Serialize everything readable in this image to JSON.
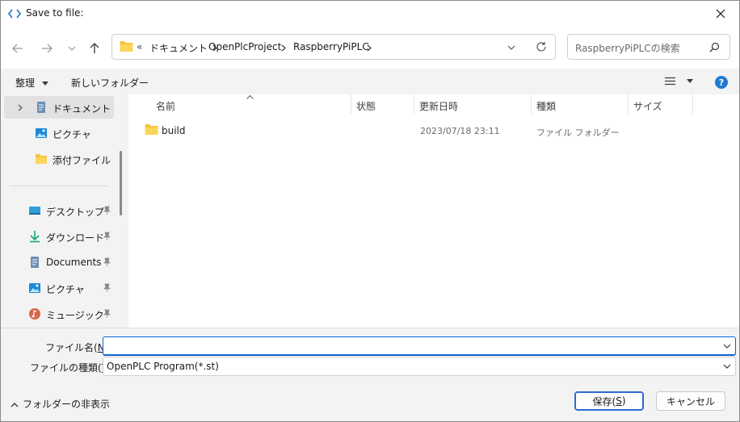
{
  "window": {
    "title": "Save to file:",
    "close_icon": "close-icon"
  },
  "nav": {
    "back_icon": "arrow-left-icon",
    "forward_icon": "arrow-right-icon",
    "recent_icon": "chevron-down-icon",
    "up_icon": "arrow-up-icon",
    "address": {
      "overflow": "«",
      "segments": [
        "ドキュメント",
        "OpenPlcProject",
        "RaspberryPiPLC"
      ]
    },
    "search_placeholder": "RaspberryPiPLCの検索"
  },
  "toolbar": {
    "organize_label": "整理",
    "new_folder_label": "新しいフォルダー",
    "view_icon": "list-view-icon",
    "help_icon": "help-icon",
    "help_glyph": "?"
  },
  "sidebar": {
    "items": [
      {
        "label": "ドキュメント",
        "icon": "documents-icon",
        "selected": true
      },
      {
        "label": "ピクチャ",
        "icon": "pictures-icon"
      },
      {
        "label": "添付ファイル",
        "icon": "folder-icon"
      },
      {
        "label": "デスクトップ",
        "icon": "desktop-icon",
        "pinned": true
      },
      {
        "label": "ダウンロード",
        "icon": "download-icon",
        "pinned": true
      },
      {
        "label": "Documents",
        "icon": "documents-icon",
        "pinned": true
      },
      {
        "label": "ピクチャ",
        "icon": "pictures-icon",
        "pinned": true
      },
      {
        "label": "ミュージック",
        "icon": "music-icon",
        "pinned": true
      }
    ]
  },
  "file_list": {
    "columns": [
      "名前",
      "状態",
      "更新日時",
      "種類",
      "サイズ"
    ],
    "rows": [
      {
        "name": "build",
        "status": "",
        "modified": "2023/07/18 23:11",
        "type": "ファイル フォルダー",
        "size": ""
      }
    ]
  },
  "form": {
    "filename_label_pre": "ファイル名(",
    "filename_label_key": "N",
    "filename_label_post": "):",
    "filename_value": "",
    "filetype_label_pre": "ファイルの種類(",
    "filetype_label_key": "T",
    "filetype_label_post": "):",
    "filetype_value": "OpenPLC Program(*.st)",
    "hide_folders_label": "フォルダーの非表示",
    "save_label_pre": "保存(",
    "save_label_key": "S",
    "save_label_post": ")",
    "cancel_label": "キャンセル"
  },
  "colors": {
    "accent": "#0a64d0",
    "folder": "#f5c343",
    "help": "#1f7ad1"
  }
}
